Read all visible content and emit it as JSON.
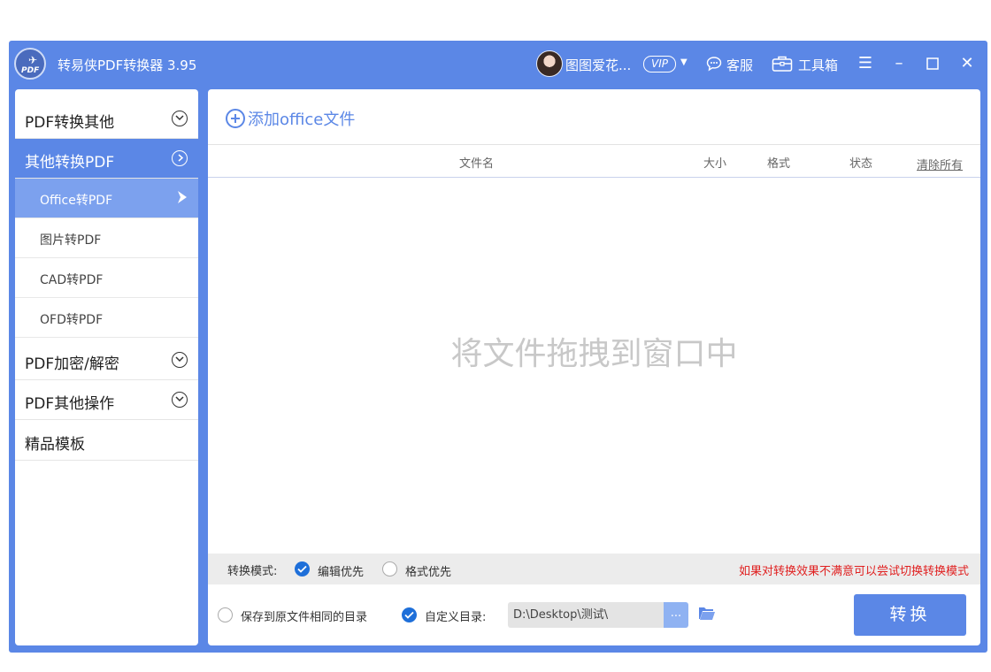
{
  "app": {
    "title": "转易侠PDF转换器 3.95",
    "logo_text": "PDF"
  },
  "header": {
    "username": "图图爱花...",
    "vip": "VIP",
    "service_label": "客服",
    "toolbox_label": "工具箱",
    "icons": [
      "menu-icon",
      "minimize-icon",
      "maximize-icon",
      "close-icon"
    ]
  },
  "sidebar": {
    "groups": [
      {
        "label": "PDF转换其他"
      },
      {
        "label": "其他转换PDF"
      },
      {
        "label": "PDF加密/解密"
      },
      {
        "label": "PDF其他操作"
      },
      {
        "label": "精品模板"
      }
    ],
    "sub_items": [
      {
        "label": "Office转PDF"
      },
      {
        "label": "图片转PDF"
      },
      {
        "label": "CAD转PDF"
      },
      {
        "label": "OFD转PDF"
      }
    ]
  },
  "main": {
    "add_label": "添加office文件",
    "columns": {
      "name": "文件名",
      "size": "大小",
      "format": "格式",
      "status": "状态"
    },
    "clear_all": "清除所有",
    "drop_hint": "将文件拖拽到窗口中",
    "mode": {
      "label": "转换模式:",
      "option_edit": "编辑优先",
      "option_format": "格式优先",
      "tip": "如果对转换效果不满意可以尝试切换转换模式"
    },
    "output": {
      "same_dir": "保存到原文件相同的目录",
      "custom_dir": "自定义目录:",
      "path": "D:\\Desktop\\测试\\",
      "browse": "...",
      "convert": "转换"
    }
  },
  "colors": {
    "accent": "#5b87e6",
    "active_sub": "#7ca1ee",
    "checked": "#1e6fd9",
    "tip": "#e02020"
  }
}
